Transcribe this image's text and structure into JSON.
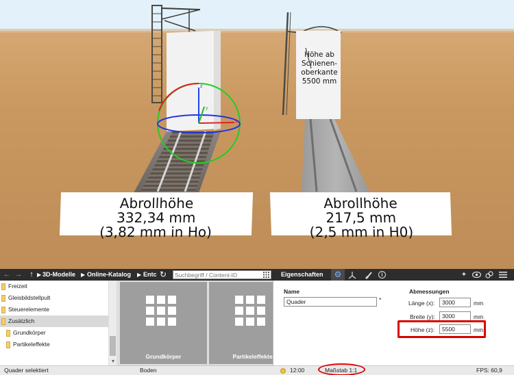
{
  "scene": {
    "left_plate": {
      "line1": "Abrollhöhe",
      "line2": "332,34 mm",
      "line3": "(3,82 mm in Ho)"
    },
    "right_plate": {
      "line1": "Abrollhöhe",
      "line2": "217,5 mm",
      "line3": "(2,5 mm in H0)"
    },
    "box_label": {
      "line1": "Höhe ab",
      "line2": "Schienen-",
      "line3": "oberkante",
      "line4": "5500 mm"
    },
    "gizmo": {
      "z": "z",
      "y": "y",
      "x": "x"
    }
  },
  "toolbar": {
    "back_icon": "back-arrow-icon",
    "forward_icon": "forward-arrow-icon",
    "up_icon": "up-arrow-icon",
    "breadcrumbs": [
      "3D-Modelle",
      "Online-Katalog",
      "Entc"
    ],
    "refresh_icon": "refresh-icon",
    "search_placeholder": "Suchbegriff / Content-ID",
    "properties_title": "Eigenschaften",
    "tab_icons": [
      "gear-icon",
      "axes-icon",
      "brush-icon",
      "info-icon"
    ],
    "right_icons": [
      "pin-icon",
      "eye-icon",
      "link-icon",
      "menu-icon"
    ]
  },
  "tree": {
    "items": [
      {
        "label": "Freizeit",
        "selected": false,
        "indent": 0
      },
      {
        "label": "Gleisbildstellpult",
        "selected": false,
        "indent": 0
      },
      {
        "label": "Steuerelemente",
        "selected": false,
        "indent": 0
      },
      {
        "label": "Zusätzlich",
        "selected": true,
        "indent": 0
      },
      {
        "label": "Grundkörper",
        "selected": false,
        "indent": 1
      },
      {
        "label": "Partikeleffekte",
        "selected": false,
        "indent": 1
      }
    ]
  },
  "tiles": [
    {
      "label": "Grundkörper"
    },
    {
      "label": "Partikeleffekte"
    }
  ],
  "properties": {
    "name_heading": "Name",
    "name_value": "Quader",
    "name_marker": "*",
    "dimensions_heading": "Abmessungen",
    "length_label": "Länge (x):",
    "length_value": "3000",
    "width_label": "Breite (y):",
    "width_value": "3000",
    "height_label": "Höhe (z):",
    "height_value": "5500",
    "unit": "mm"
  },
  "status": {
    "selection": "Quader selektiert",
    "surface": "Boden",
    "time": "12:00",
    "scale": "Maßstab 1:1",
    "fps": "FPS: 60,9"
  },
  "colors": {
    "highlight": "#dc0000",
    "toolbar_bg": "#2d2d2d",
    "ground": "#c99860",
    "sky": "#e3f1fa"
  }
}
